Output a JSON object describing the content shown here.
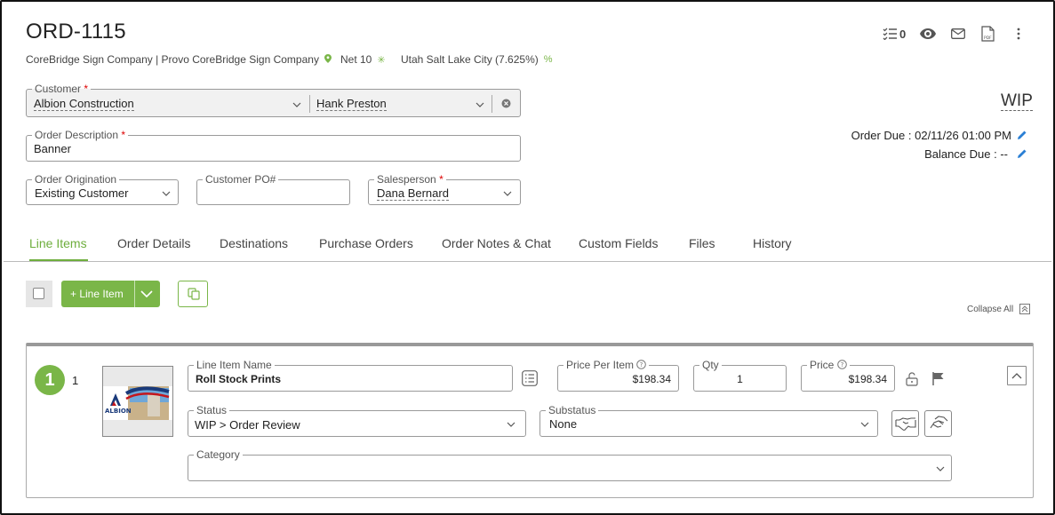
{
  "order": {
    "id": "ORD-1115",
    "company": "CoreBridge Sign Company | Provo CoreBridge Sign Company",
    "terms": "Net 10",
    "tax": "Utah Salt Lake City (7.625%)",
    "task_count": "0",
    "status": "WIP",
    "due_label": "Order Due : 02/11/26 01:00 PM",
    "balance_label": "Balance Due : --"
  },
  "form": {
    "customer_label": "Customer",
    "customer_value": "Albion Construction",
    "contact_value": "Hank Preston",
    "description_label": "Order Description",
    "description_value": "Banner",
    "origination_label": "Order Origination",
    "origination_value": "Existing Customer",
    "po_label": "Customer PO#",
    "po_value": "",
    "salesperson_label": "Salesperson",
    "salesperson_value": "Dana Bernard",
    "required_mark": "*"
  },
  "tabs": [
    {
      "label": "Line Items",
      "active": true
    },
    {
      "label": "Order Details"
    },
    {
      "label": "Destinations"
    },
    {
      "label": "Purchase Orders"
    },
    {
      "label": "Order Notes & Chat"
    },
    {
      "label": "Custom Fields"
    },
    {
      "label": "Files"
    },
    {
      "label": "History"
    }
  ],
  "toolbar": {
    "add_line_item": "+ Line Item",
    "collapse_all": "Collapse All"
  },
  "line_item": {
    "badge": "1",
    "number": "1",
    "thumb_text": "ALBION",
    "name_label": "Line Item Name",
    "name_value": "Roll Stock Prints",
    "ppi_label": "Price Per Item",
    "ppi_value": "$198.34",
    "qty_label": "Qty",
    "qty_value": "1",
    "price_label": "Price",
    "price_value": "$198.34",
    "status_label": "Status",
    "status_value": "WIP > Order Review",
    "substatus_label": "Substatus",
    "substatus_value": "None",
    "category_label": "Category",
    "category_value": ""
  },
  "colors": {
    "accent": "#7ab648",
    "required": "#dd0000",
    "edit": "#2a7fd4"
  }
}
